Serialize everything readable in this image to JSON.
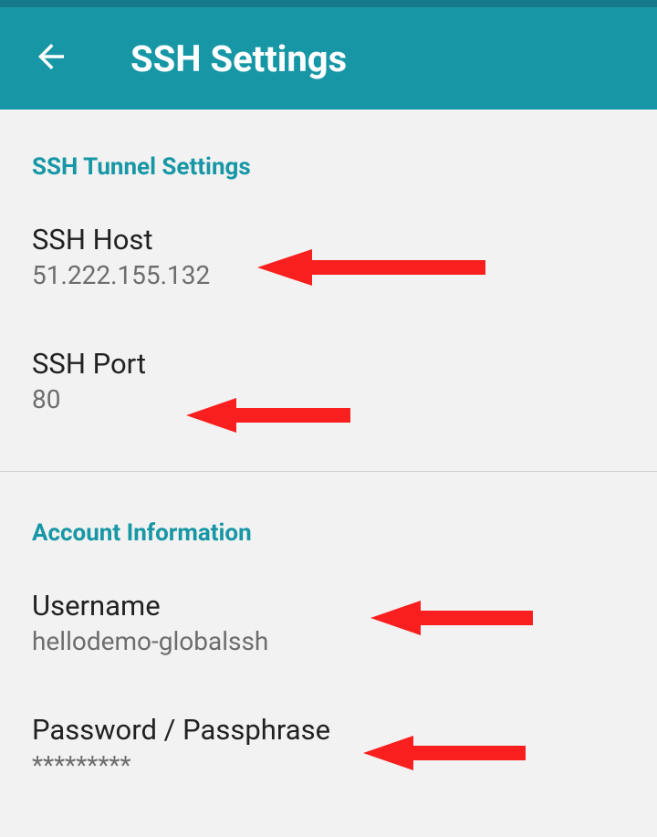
{
  "header": {
    "title": "SSH Settings"
  },
  "sections": {
    "tunnel": {
      "header": "SSH Tunnel Settings",
      "host": {
        "label": "SSH Host",
        "value": "51.222.155.132"
      },
      "port": {
        "label": "SSH Port",
        "value": "80"
      }
    },
    "account": {
      "header": "Account Information",
      "username": {
        "label": "Username",
        "value": "hellodemo-globalssh"
      },
      "password": {
        "label": "Password / Passphrase",
        "value": "*********"
      }
    }
  }
}
